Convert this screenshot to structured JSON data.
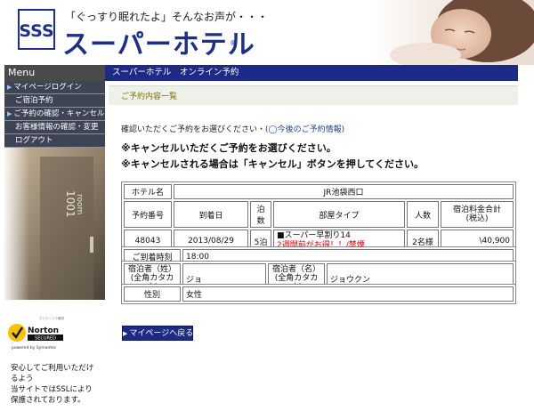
{
  "header": {
    "tagline": "「ぐっすり眠れたよ」そんなお声が・・・",
    "brand": "スーパーホテル",
    "brand_mark": "®",
    "logo_letters": "SSS"
  },
  "sidebar": {
    "menu_title": "Menu",
    "items": [
      {
        "label": "マイページログイン",
        "arrow": true
      },
      {
        "label": "ご宿泊予約",
        "arrow": false
      },
      {
        "label": "ご予約の確認・キャンセル",
        "arrow": true
      },
      {
        "label": "お客様情報の確認・変更",
        "arrow": false
      },
      {
        "label": "ログアウト",
        "arrow": false
      }
    ],
    "door_number": "1001",
    "door_word": "room",
    "norton_name": "Norton",
    "norton_secured": "SECURED",
    "norton_powered": "powered by Symantec",
    "norton_top": "ワンクリック確認",
    "secure_note": [
      "安心してご利用いただけ",
      "るよう",
      "当サイトではSSLにより",
      "保護されております。"
    ]
  },
  "topnav": {
    "label": "スーパーホテル　オンライン予約"
  },
  "page_title": "ご予約内容一覧",
  "confirm": {
    "text": "確認いただくご予約をお選びください・",
    "link": "(◯今後のご予約情報)"
  },
  "notes": [
    "※キャンセルいただくご予約をお選びください。",
    "※キャンセルされる場合は「キャンセル」ボタンを押してください。"
  ],
  "reservation": {
    "hotel_label": "ホテル名",
    "hotel_name": "JR池袋西口",
    "headers": [
      "予約番号",
      "到着日",
      "泊数",
      "部屋タイプ",
      "人数",
      "宿泊料金合計\n(税込)"
    ],
    "row": {
      "number": "48043",
      "arrival": "2013/08/29",
      "nights": "5泊",
      "room_line1": "■スーパー早割り14",
      "room_line2": "2週間前がお得！！/禁煙",
      "guests": "2名様",
      "total": "\\40,900"
    }
  },
  "arrival_time": {
    "label": "ご到着時刻",
    "value": "18:00"
  },
  "guest": {
    "last_label": "宿泊者（姓）\n(全角カタカナ)",
    "last_value": "ジョ",
    "first_label": "宿泊者（名）\n(全角カタカナ)",
    "first_value": "ジョウクン"
  },
  "gender": {
    "label": "性別",
    "value": "女性"
  },
  "buttons": {
    "mypage": "マイページへ戻る"
  },
  "colors": {
    "navy": "#1e2b86",
    "brand_blue": "#1d2f8a",
    "alert_red": "#dd0000"
  }
}
